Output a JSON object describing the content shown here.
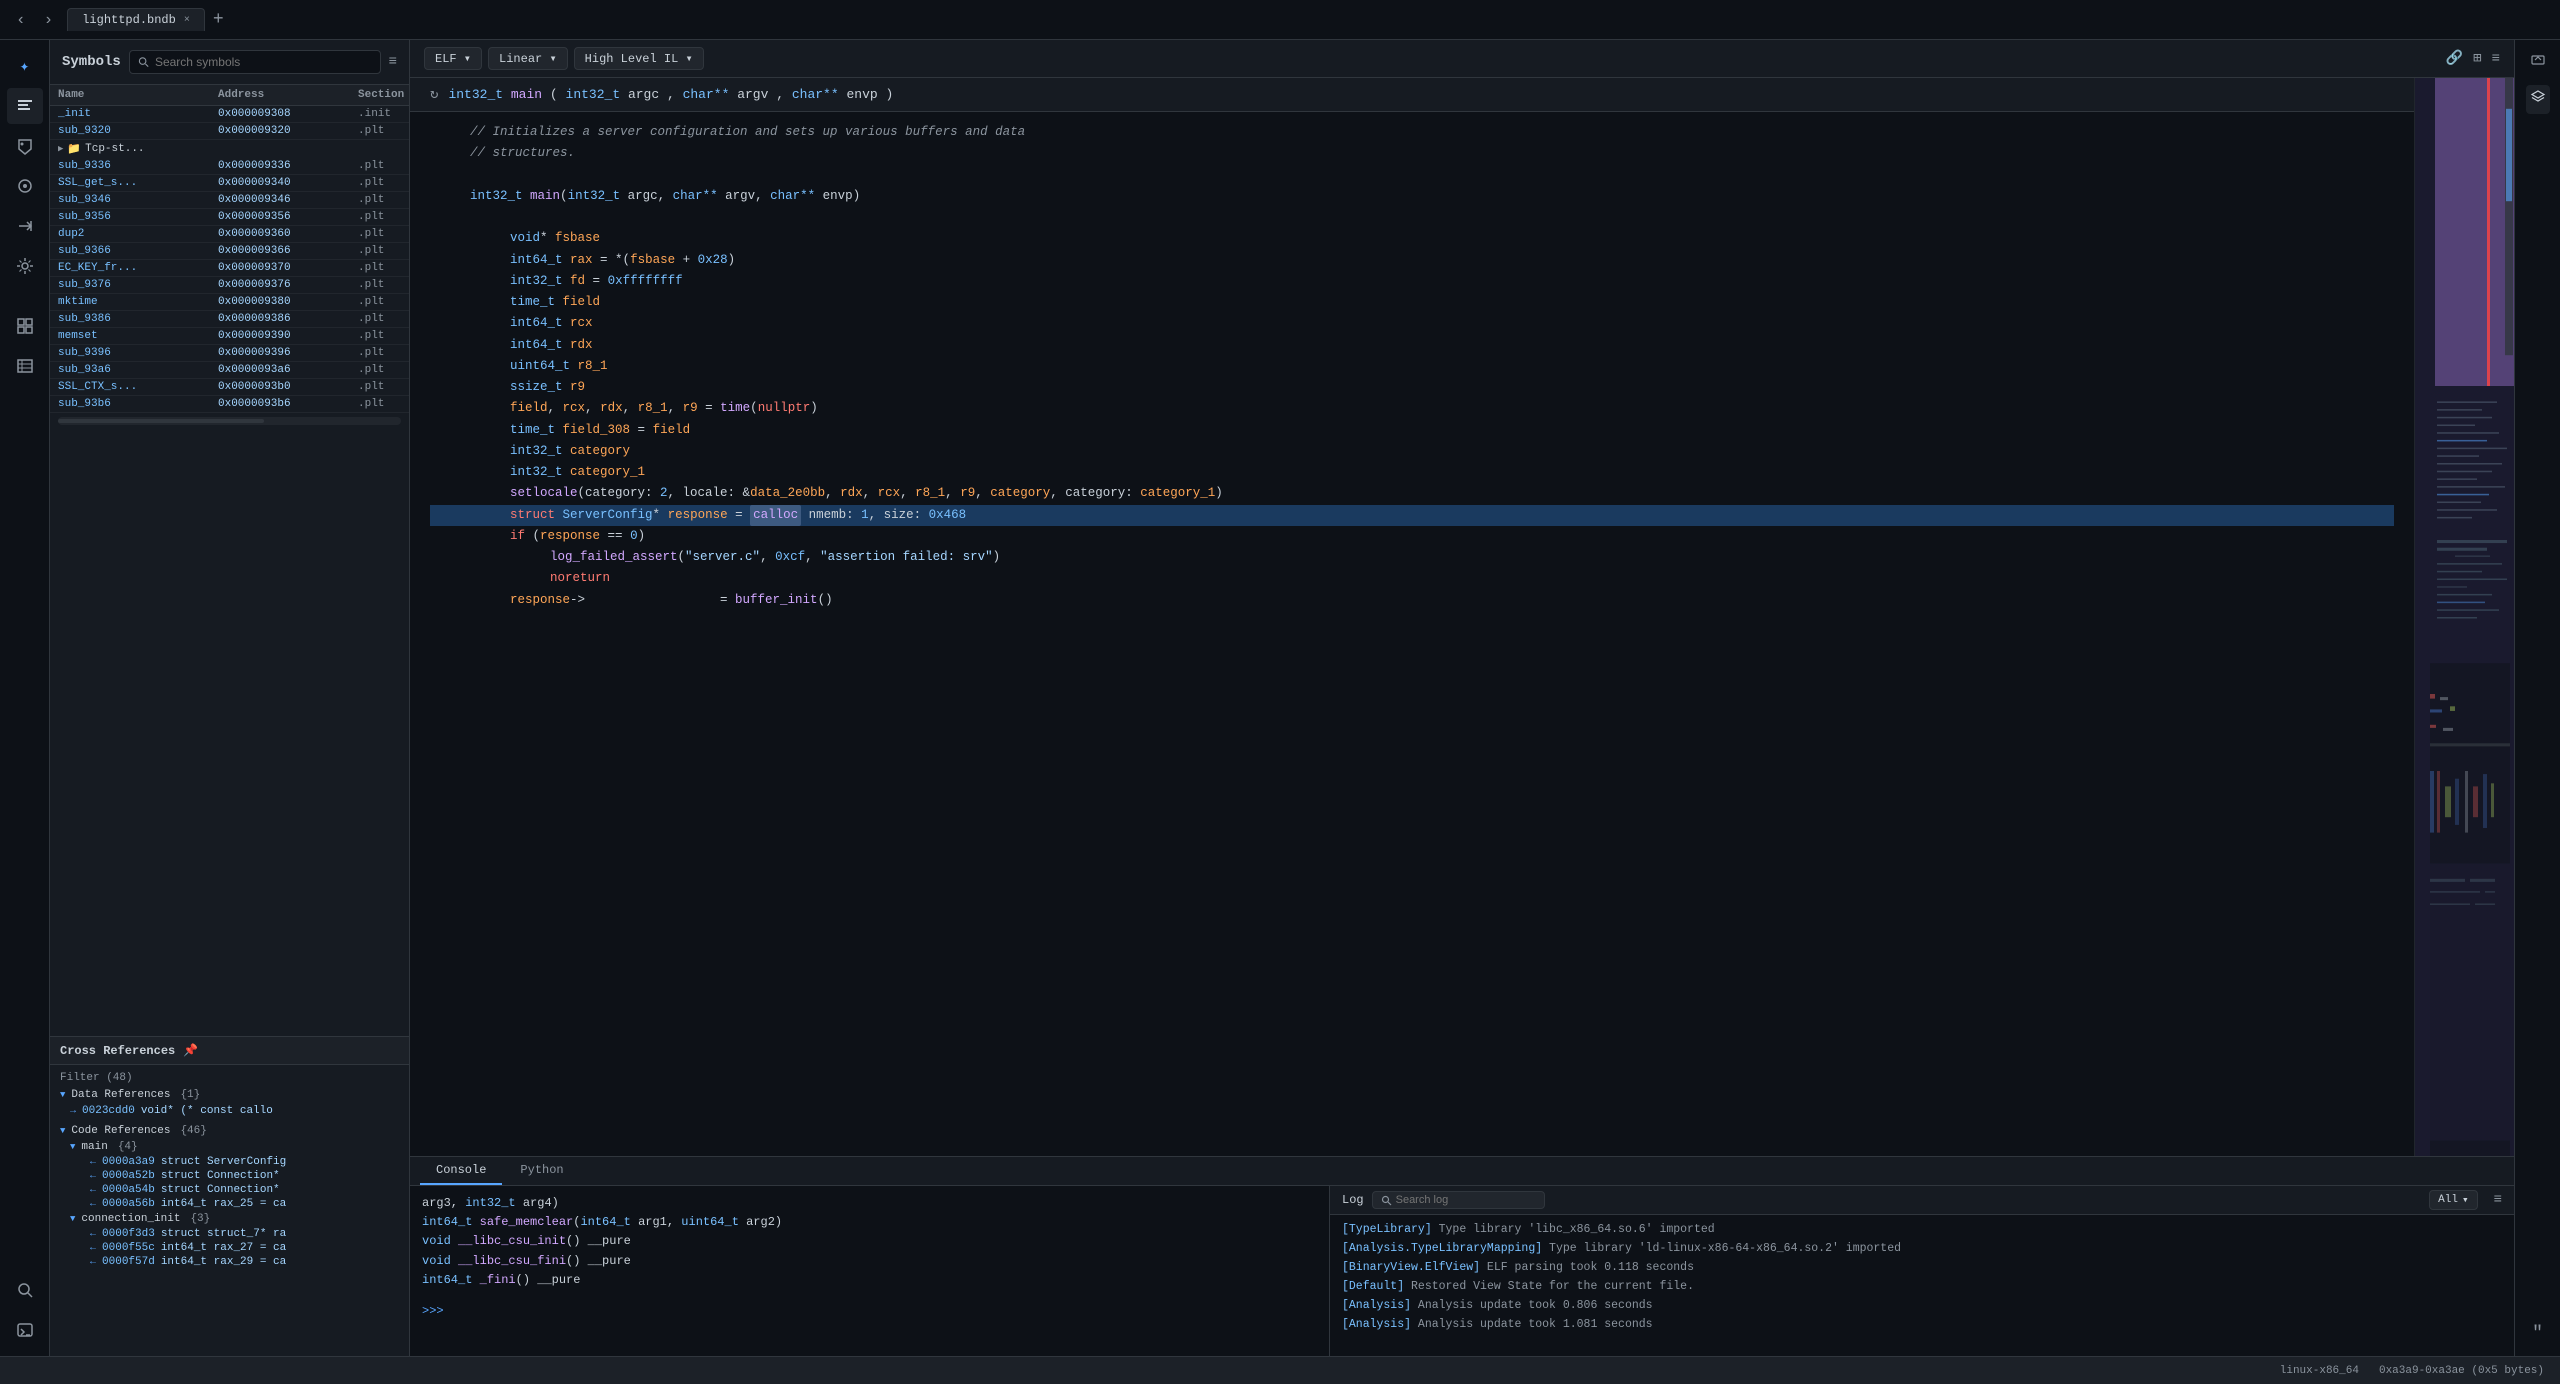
{
  "titlebar": {
    "tab_label": "lighttpd.bndb",
    "close_label": "×",
    "add_tab_label": "+"
  },
  "toolbar": {
    "elf_label": "ELF ▾",
    "linear_label": "Linear ▾",
    "hlil_label": "High Level IL ▾"
  },
  "sidebar": {
    "title": "Symbols",
    "search_placeholder": "Search symbols",
    "menu_icon": "≡",
    "columns": {
      "name": "Name",
      "address": "Address",
      "section": "Section"
    },
    "symbols": [
      {
        "name": "_init",
        "address": "0x000009308",
        "section": ".init"
      },
      {
        "name": "sub_9320",
        "address": "0x000009320",
        "section": ".plt"
      },
      {
        "name": "Tcp-st...",
        "address": "",
        "section": "",
        "is_folder": true
      },
      {
        "name": "sub_9336",
        "address": "0x000009336",
        "section": ".plt"
      },
      {
        "name": "SSL_get_s...",
        "address": "0x000009340",
        "section": ".plt"
      },
      {
        "name": "sub_9346",
        "address": "0x000009346",
        "section": ".plt"
      },
      {
        "name": "sub_9356",
        "address": "0x000009356",
        "section": ".plt"
      },
      {
        "name": "dup2",
        "address": "0x000009360",
        "section": ".plt"
      },
      {
        "name": "sub_9366",
        "address": "0x000009366",
        "section": ".plt"
      },
      {
        "name": "EC_KEY_fr...",
        "address": "0x000009370",
        "section": ".plt"
      },
      {
        "name": "sub_9376",
        "address": "0x000009376",
        "section": ".plt"
      },
      {
        "name": "mktime",
        "address": "0x000009380",
        "section": ".plt"
      },
      {
        "name": "sub_9386",
        "address": "0x000009386",
        "section": ".plt"
      },
      {
        "name": "memset",
        "address": "0x000009390",
        "section": ".plt"
      },
      {
        "name": "sub_9396",
        "address": "0x000009396",
        "section": ".plt"
      },
      {
        "name": "sub_93a6",
        "address": "0x0000093a6",
        "section": ".plt"
      },
      {
        "name": "SSL_CTX_s...",
        "address": "0x0000093b0",
        "section": ".plt"
      },
      {
        "name": "sub_93b6",
        "address": "0x0000093b6",
        "section": ".plt"
      }
    ]
  },
  "cross_references": {
    "title": "Cross References",
    "filter_label": "Filter (48)",
    "data_refs": {
      "label": "Data References",
      "count": "{1}",
      "items": [
        {
          "addr": "0023cdd0",
          "code": "void* (* const callo"
        }
      ]
    },
    "code_refs": {
      "label": "Code References",
      "count": "{46}",
      "sub_sections": [
        {
          "label": "main",
          "count": "{4}",
          "items": [
            {
              "addr": "0000a3a9",
              "code": "struct ServerConfig"
            },
            {
              "addr": "0000a52b",
              "code": "struct Connection*"
            },
            {
              "addr": "0000a54b",
              "code": "struct Connection*"
            },
            {
              "addr": "0000a56b",
              "code": "int64_t rax_25 = ca"
            }
          ]
        },
        {
          "label": "connection_init",
          "count": "{3}",
          "items": [
            {
              "addr": "0000f3d3",
              "code": "struct struct_7* ra"
            },
            {
              "addr": "0000f55c",
              "code": "int64_t rax_27 = ca"
            },
            {
              "addr": "0000f57d",
              "code": "int64_t rax_29 = ca"
            }
          ]
        }
      ]
    }
  },
  "function_header": "int32_t main(int32_t argc, char** argv, char** envp)",
  "code_lines": [
    {
      "indent": 1,
      "content": "// Initializes a server configuration and sets up various buffers and data",
      "type": "comment"
    },
    {
      "indent": 1,
      "content": "// structures.",
      "type": "comment"
    },
    {
      "indent": 0,
      "content": ""
    },
    {
      "indent": 1,
      "content": "int32_t main(int32_t argc, char** argv, char** envp)",
      "type": "signature"
    },
    {
      "indent": 0,
      "content": ""
    },
    {
      "indent": 2,
      "content": "void* fsbase",
      "type": "decl"
    },
    {
      "indent": 2,
      "content": "int64_t rax = *(fsbase + 0x28)",
      "type": "decl"
    },
    {
      "indent": 2,
      "content": "int32_t fd = 0xffffffff",
      "type": "decl"
    },
    {
      "indent": 2,
      "content": "time_t field",
      "type": "decl"
    },
    {
      "indent": 2,
      "content": "int64_t rcx",
      "type": "decl"
    },
    {
      "indent": 2,
      "content": "int64_t rdx",
      "type": "decl"
    },
    {
      "indent": 2,
      "content": "uint64_t r8_1",
      "type": "decl"
    },
    {
      "indent": 2,
      "content": "ssize_t r9",
      "type": "decl"
    },
    {
      "indent": 2,
      "content": "field, rcx, rdx, r8_1, r9 = time(nullptr)",
      "type": "stmt"
    },
    {
      "indent": 2,
      "content": "time_t field_308 = field",
      "type": "decl"
    },
    {
      "indent": 2,
      "content": "int32_t category",
      "type": "decl"
    },
    {
      "indent": 2,
      "content": "int32_t category_1",
      "type": "decl"
    },
    {
      "indent": 2,
      "content": "setlocale(category: 2, locale: &data_2e0bb, rdx, rcx, r8_1, r9, category, category: category_1)",
      "type": "stmt"
    },
    {
      "indent": 2,
      "content": "struct ServerConfig* response = calloc nmemb: 1, size: 0x468",
      "type": "highlighted"
    },
    {
      "indent": 2,
      "content": "if (response == 0)",
      "type": "stmt"
    },
    {
      "indent": 3,
      "content": "log_failed_assert(\"server.c\", 0xcf, \"assertion failed: srv\")",
      "type": "stmt"
    },
    {
      "indent": 3,
      "content": "noreturn",
      "type": "kw"
    },
    {
      "indent": 2,
      "content": "response->                  = buffer_init()",
      "type": "stmt"
    }
  ],
  "bottom_panel": {
    "tabs": [
      "Console",
      "Python"
    ],
    "active_tab": "Console",
    "console_lines": [
      "arg3, int32_t arg4)",
      "int64_t safe_memclear(int64_t arg1, uint64_t arg2)",
      "void __libc_csu_init() __pure",
      "void __libc_csu_fini() __pure",
      "int64_t _fini() __pure"
    ],
    "console_prompt": ">>>"
  },
  "log_panel": {
    "title": "Log",
    "search_placeholder": "Search log",
    "filter_label": "All",
    "entries": [
      "[TypeLibrary] Type library 'libc_x86_64.so.6' imported",
      "[Analysis.TypeLibraryMapping] Type library 'ld-linux-x86-64-x86_64.so.2' imported",
      "[BinaryView.ElfView] ELF parsing took 0.118 seconds",
      "[Default] Restored View State for the current file.",
      "[Analysis] Analysis update took 0.806 seconds",
      "[Analysis] Analysis update took 1.081 seconds"
    ]
  },
  "status_bar": {
    "arch": "linux-x86_64",
    "address": "0xa3a9-0xa3ae (0x5 bytes)"
  },
  "minimap": {
    "visible": true
  }
}
